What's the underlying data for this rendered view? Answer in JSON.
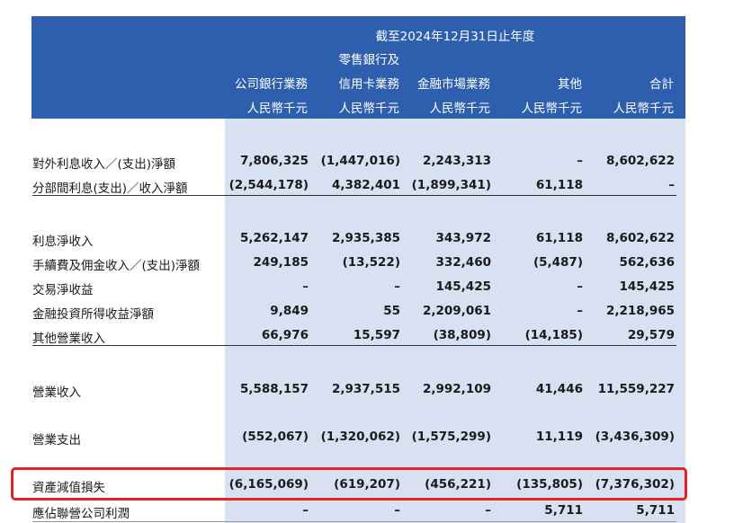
{
  "header": {
    "period": "截至2024年12月31日止年度",
    "cols": [
      {
        "line1": "",
        "line2": "公司銀行業務",
        "unit": "人民幣千元"
      },
      {
        "line1": "零售銀行及",
        "line2": "信用卡業務",
        "unit": "人民幣千元"
      },
      {
        "line1": "",
        "line2": "金融市場業務",
        "unit": "人民幣千元"
      },
      {
        "line1": "",
        "line2": "其他",
        "unit": "人民幣千元"
      },
      {
        "line1": "",
        "line2": "合計",
        "unit": "人民幣千元"
      }
    ]
  },
  "rows": [
    {
      "label": "對外利息收入／(支出)淨額",
      "values": [
        "7,806,325",
        "(1,447,016)",
        "2,243,313",
        "–",
        "8,602,622"
      ]
    },
    {
      "label": "分部間利息(支出)／收入淨額",
      "values": [
        "(2,544,178)",
        "4,382,401",
        "(1,899,341)",
        "61,118",
        "–"
      ]
    },
    {
      "label": "利息淨收入",
      "values": [
        "5,262,147",
        "2,935,385",
        "343,972",
        "61,118",
        "8,602,622"
      ]
    },
    {
      "label": "手續費及佣金收入／(支出)淨額",
      "values": [
        "249,185",
        "(13,522)",
        "332,460",
        "(5,487)",
        "562,636"
      ]
    },
    {
      "label": "交易淨收益",
      "values": [
        "–",
        "–",
        "145,425",
        "–",
        "145,425"
      ]
    },
    {
      "label": "金融投資所得收益淨額",
      "values": [
        "9,849",
        "55",
        "2,209,061",
        "–",
        "2,218,965"
      ]
    },
    {
      "label": "其他營業收入",
      "values": [
        "66,976",
        "15,597",
        "(38,809)",
        "(14,185)",
        "29,579"
      ]
    },
    {
      "label": "營業收入",
      "values": [
        "5,588,157",
        "2,937,515",
        "2,992,109",
        "41,446",
        "11,559,227"
      ]
    },
    {
      "label": "營業支出",
      "values": [
        "(552,067)",
        "(1,320,062)",
        "(1,575,299)",
        "11,119",
        "(3,436,309)"
      ]
    },
    {
      "label": "資產減值損失",
      "values": [
        "(6,165,069)",
        "(619,207)",
        "(456,221)",
        "(135,805)",
        "(7,376,302)"
      ]
    },
    {
      "label": "應佔聯營公司利潤",
      "values": [
        "–",
        "–",
        "–",
        "5,711",
        "5,711"
      ]
    }
  ]
}
